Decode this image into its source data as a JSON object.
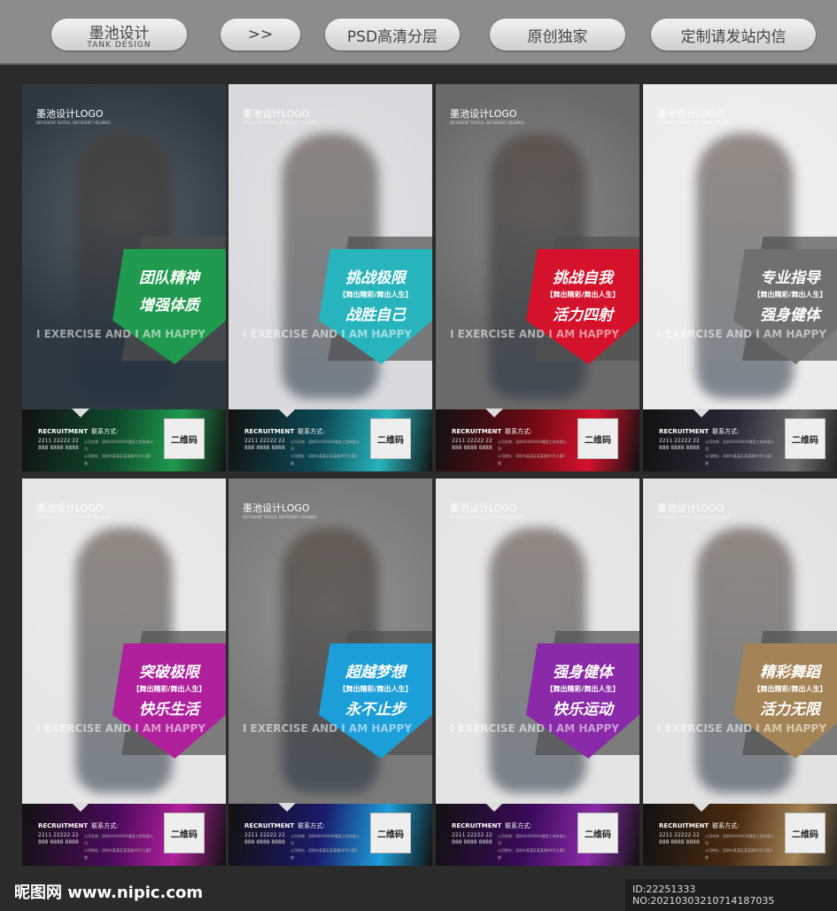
{
  "topbar": {
    "buttons": [
      {
        "label": "墨池设计",
        "sub": "TANK DESIGN"
      },
      {
        "label": ">>"
      },
      {
        "label": "PSD高清分层"
      },
      {
        "label": "原创独家"
      },
      {
        "label": "定制请发站内信"
      }
    ]
  },
  "poster_common": {
    "logo": "墨池设计LOGO",
    "logo_sub": "DIFFERENT TASTES, DIFFERENT FEELINGS",
    "motto": "I EXERCISE AND I AM HAPPY",
    "recruit": "RECRUITMENT",
    "contact_label": "联系方式:",
    "phone1": "2211 22222 22",
    "phone2": "888 8888 8888",
    "company": "公司名称：深圳XXXXXXXX健身工程有限公司",
    "address": "公司地址：深圳市某某区某某路XX号大厦C座",
    "qr": "二维码"
  },
  "posters": [
    {
      "h1": "团队精神",
      "sub": "",
      "h2": "增强体质",
      "color": "#1f9a4e",
      "bg": "#2d3a44",
      "foot": "#0e4a2a"
    },
    {
      "h1": "挑战极限",
      "sub": "【舞出精彩/舞出人生】",
      "h2": "战胜自己",
      "color": "#28b4bc",
      "bg": "#d8dadd",
      "foot": "#0c4a56"
    },
    {
      "h1": "挑战自我",
      "sub": "【舞出精彩/舞出人生】",
      "h2": "活力四射",
      "color": "#d5122c",
      "bg": "#6a6a6a",
      "foot": "#6a0a12"
    },
    {
      "h1": "专业指导",
      "sub": "【舞出精彩/舞出人生】",
      "h2": "强身健体",
      "color": "#707070",
      "bg": "#ececec",
      "foot": "#2a2a3a"
    },
    {
      "h1": "突破极限",
      "sub": "【舞出精彩/舞出人生】",
      "h2": "快乐生活",
      "color": "#b0209c",
      "bg": "#e6e6e6",
      "foot": "#4a0a5a"
    },
    {
      "h1": "超越梦想",
      "sub": "【舞出精彩/舞出人生】",
      "h2": "永不止步",
      "color": "#1c9ed8",
      "bg": "#7a7a78",
      "foot": "#1a1a6a"
    },
    {
      "h1": "强身健体",
      "sub": "【舞出精彩/舞出人生】",
      "h2": "快乐运动",
      "color": "#8a2aa8",
      "bg": "#e4e4e4",
      "foot": "#3a0a5a"
    },
    {
      "h1": "精彩舞蹈",
      "sub": "【舞出精彩/舞出人生】",
      "h2": "活力无限",
      "color": "#a48456",
      "bg": "#e2e2e2",
      "foot": "#4a2a10"
    }
  ],
  "footer": {
    "watermark": "昵图网 www.nipic.com",
    "id": "ID:22251333 NO:20210303210714187035"
  }
}
